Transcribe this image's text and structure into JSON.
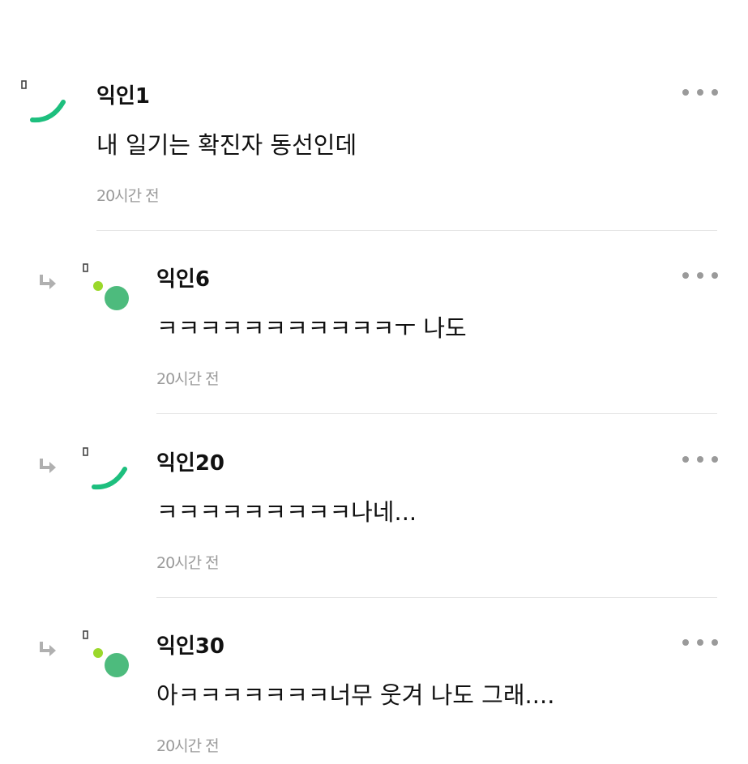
{
  "comments": [
    {
      "author": "익인1",
      "text": "내 일기는 확진자 동선인데",
      "time": "20시간 전",
      "avatar": "arc",
      "reply": false
    },
    {
      "author": "익인6",
      "text": "ㅋㅋㅋㅋㅋㅋㅋㅋㅋㅋㅋㅜ 나도",
      "time": "20시간 전",
      "avatar": "dot",
      "reply": true
    },
    {
      "author": "익인20",
      "text": "ㅋㅋㅋㅋㅋㅋㅋㅋㅋ나네...",
      "time": "20시간 전",
      "avatar": "arc",
      "reply": true
    },
    {
      "author": "익인30",
      "text": "아ㅋㅋㅋㅋㅋㅋㅋ너무 웃겨 나도 그래....",
      "time": "20시간 전",
      "avatar": "dot",
      "reply": true
    }
  ],
  "colors": {
    "avatar_green": "#1dbf7e",
    "avatar_circle": "#4dbb7d",
    "avatar_lime": "#9ad82a",
    "meta_gray": "#9a9a9a",
    "divider": "#e6e6e6"
  },
  "icons": {
    "reply": "reply-arrow-icon",
    "more": "more-dots-icon"
  }
}
